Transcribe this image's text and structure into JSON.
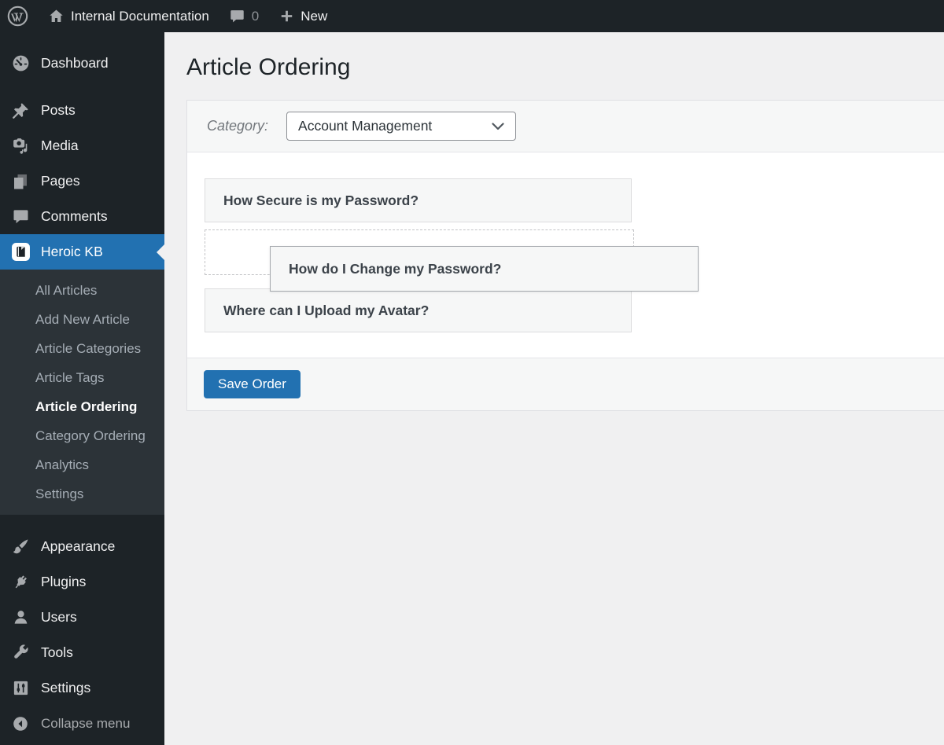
{
  "admin_bar": {
    "site_name": "Internal Documentation",
    "comments_count": "0",
    "new_label": "New"
  },
  "sidebar": {
    "items": [
      {
        "label": "Dashboard",
        "icon": "dashboard-icon"
      },
      {
        "label": "Posts",
        "icon": "pushpin-icon"
      },
      {
        "label": "Media",
        "icon": "media-icon"
      },
      {
        "label": "Pages",
        "icon": "pages-icon"
      },
      {
        "label": "Comments",
        "icon": "comment-icon"
      },
      {
        "label": "Heroic KB",
        "icon": "book-icon",
        "active": true
      },
      {
        "label": "Appearance",
        "icon": "brush-icon"
      },
      {
        "label": "Plugins",
        "icon": "plug-icon"
      },
      {
        "label": "Users",
        "icon": "user-icon"
      },
      {
        "label": "Tools",
        "icon": "wrench-icon"
      },
      {
        "label": "Settings",
        "icon": "sliders-icon"
      }
    ],
    "submenu": [
      "All Articles",
      "Add New Article",
      "Article Categories",
      "Article Tags",
      "Article Ordering",
      "Category Ordering",
      "Analytics",
      "Settings"
    ],
    "submenu_current": "Article Ordering",
    "collapse_label": "Collapse menu"
  },
  "main": {
    "title": "Article Ordering",
    "category_label": "Category:",
    "category_value": "Account Management",
    "articles": [
      "How Secure is my Password?",
      "How do I Change my Password?",
      "Where can I Upload my Avatar?"
    ],
    "save_button": "Save Order"
  },
  "colors": {
    "accent_blue": "#2271b1",
    "admin_dark": "#1d2327",
    "submenu_dark": "#2c3338",
    "page_bg": "#f0f0f1",
    "panel_gray": "#f6f7f7",
    "icon_gray": "#a7aaad"
  }
}
